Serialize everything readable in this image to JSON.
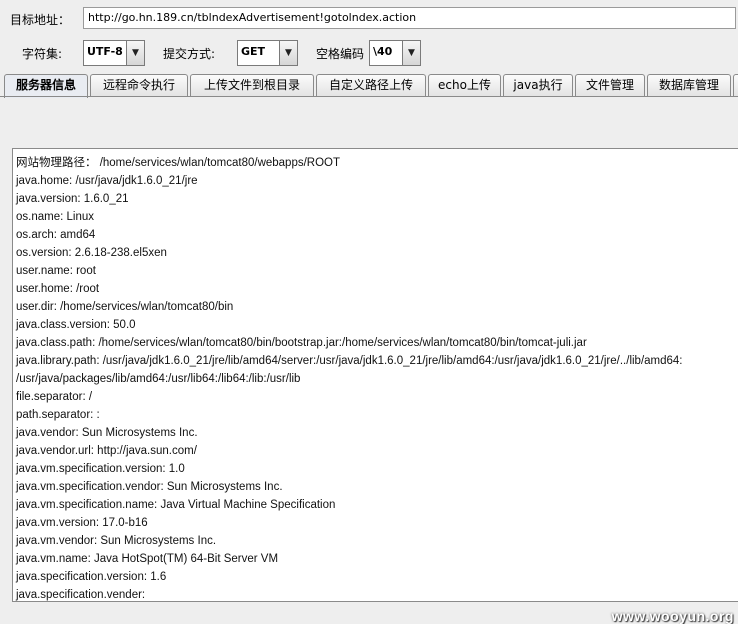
{
  "form": {
    "target_label": "目标地址：",
    "target_url": "http://go.hn.189.cn/tblndexAdvertisement!gotolndex.action",
    "charset_label": "字符集:",
    "charset_value": "UTF-8",
    "method_label": "提交方式:",
    "method_value": "GET",
    "space_label": "空格编码",
    "space_value": "\\40"
  },
  "tabs": [
    {
      "label": "服务器信息",
      "active": true
    },
    {
      "label": "远程命令执行",
      "active": false
    },
    {
      "label": "上传文件到根目录",
      "active": false
    },
    {
      "label": "自定义路径上传",
      "active": false
    },
    {
      "label": "echo上传",
      "active": false
    },
    {
      "label": "java执行",
      "active": false
    },
    {
      "label": "文件管理",
      "active": false
    },
    {
      "label": "数据库管理",
      "active": false
    }
  ],
  "output_lines": [
    "网站物理路径： /home/services/wlan/tomcat80/webapps/ROOT",
    "java.home: /usr/java/jdk1.6.0_21/jre",
    "java.version: 1.6.0_21",
    "os.name: Linux",
    "os.arch: amd64",
    "os.version: 2.6.18-238.el5xen",
    "user.name: root",
    "user.home: /root",
    "user.dir: /home/services/wlan/tomcat80/bin",
    "java.class.version: 50.0",
    "java.class.path: /home/services/wlan/tomcat80/bin/bootstrap.jar:/home/services/wlan/tomcat80/bin/tomcat-juli.jar",
    "java.library.path: /usr/java/jdk1.6.0_21/jre/lib/amd64/server:/usr/java/jdk1.6.0_21/jre/lib/amd64:/usr/java/jdk1.6.0_21/jre/../lib/amd64:",
    "/usr/java/packages/lib/amd64:/usr/lib64:/lib64:/lib:/usr/lib",
    "file.separator: /",
    "path.separator: :",
    "java.vendor: Sun Microsystems Inc.",
    "java.vendor.url: http://java.sun.com/",
    "java.vm.specification.version: 1.0",
    "java.vm.specification.vendor: Sun Microsystems Inc.",
    "java.vm.specification.name: Java Virtual Machine Specification",
    "java.vm.version: 17.0-b16",
    "java.vm.vendor: Sun Microsystems Inc.",
    "java.vm.name: Java HotSpot(TM) 64-Bit Server VM",
    "java.specification.version: 1.6",
    "java.specification.vender:"
  ],
  "watermark": "www.wooyun.org"
}
